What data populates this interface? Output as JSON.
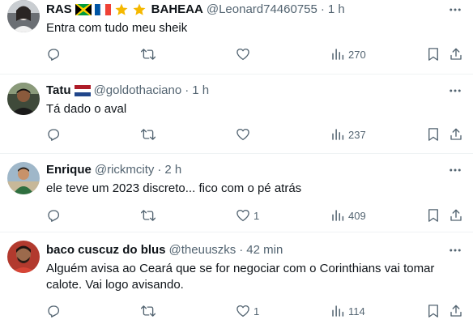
{
  "replies": [
    {
      "name": "RAS",
      "name_suffix": "BAHEAA",
      "handle": "@Leonard74460755",
      "separator": "·",
      "time": "1 h",
      "text": "Entra com tudo meu sheik",
      "comments": "",
      "retweets": "",
      "likes": "",
      "views": "270"
    },
    {
      "name": "Tatu",
      "handle": "@goldothaciano",
      "separator": "·",
      "time": "1 h",
      "text": "Tá dado o aval",
      "comments": "",
      "retweets": "",
      "likes": "",
      "views": "237"
    },
    {
      "name": "Enrique",
      "handle": "@rickmcity",
      "separator": "·",
      "time": "2 h",
      "text": "ele teve um 2023 discreto... fico com o pé atrás",
      "comments": "",
      "retweets": "",
      "likes": "1",
      "views": "409"
    },
    {
      "name": "baco cuscuz do blus",
      "handle": "@theuuszks",
      "separator": "·",
      "time": "42 min",
      "text": "Alguém avisa ao Ceará que se for negociar com o Corinthians vai tomar calote. Vai logo avisando.",
      "comments": "",
      "retweets": "",
      "likes": "1",
      "views": "114"
    }
  ],
  "colors": {
    "text": "#0f1419",
    "muted": "#536471",
    "divider": "#eff3f4",
    "star": "#f5b800"
  },
  "icons": [
    "more-icon",
    "reply-icon",
    "retweet-icon",
    "like-icon",
    "views-icon",
    "bookmark-icon",
    "share-icon",
    "jamaica-flag-icon",
    "france-flag-icon",
    "star-icon",
    "netherlands-flag-icon"
  ]
}
